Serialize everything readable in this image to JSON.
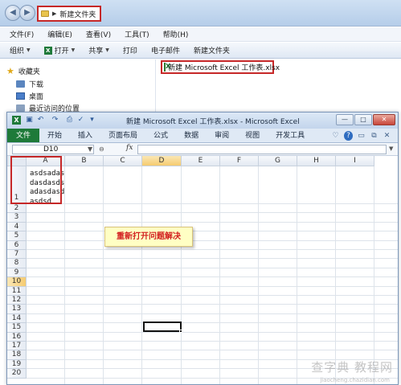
{
  "explorer": {
    "address": "新建文件夹",
    "menu": [
      "文件(F)",
      "编辑(E)",
      "查看(V)",
      "工具(T)",
      "帮助(H)"
    ],
    "toolbar": {
      "organize": "组织",
      "open": "打开",
      "share": "共享",
      "print": "打印",
      "email": "电子邮件",
      "new_folder": "新建文件夹"
    },
    "nav": {
      "favorites": "收藏夹",
      "downloads": "下载",
      "desktop": "桌面",
      "recent": "最近访问的位置"
    },
    "file": "新建 Microsoft Excel 工作表.xlsx"
  },
  "excel": {
    "title": "新建 Microsoft Excel 工作表.xlsx - Microsoft Excel",
    "tabs": {
      "file": "文件",
      "items": [
        "开始",
        "插入",
        "页面布局",
        "公式",
        "数据",
        "审阅",
        "视图",
        "开发工具"
      ]
    },
    "name_box": "D10",
    "formula_value": "",
    "columns": [
      "A",
      "B",
      "C",
      "D",
      "E",
      "F",
      "G",
      "H",
      "I"
    ],
    "selected_column": "D",
    "rows": [
      "1",
      "2",
      "3",
      "4",
      "5",
      "6",
      "7",
      "8",
      "9",
      "10",
      "11",
      "12",
      "13",
      "14",
      "15",
      "16",
      "17",
      "18",
      "19",
      "20"
    ],
    "selected_row": "10",
    "cell_a1_lines": [
      "asdsadas",
      "dasdasds",
      "adasdasd",
      "asdsd"
    ]
  },
  "annotation": "重新打开问题解决",
  "watermark": "查字典 教程网",
  "watermark_url": "jiaocheng.chazidian.com",
  "colors": {
    "highlight_border": "#c62828",
    "annotation_text": "#d32020",
    "excel_file_tab": "#1e7a39"
  }
}
